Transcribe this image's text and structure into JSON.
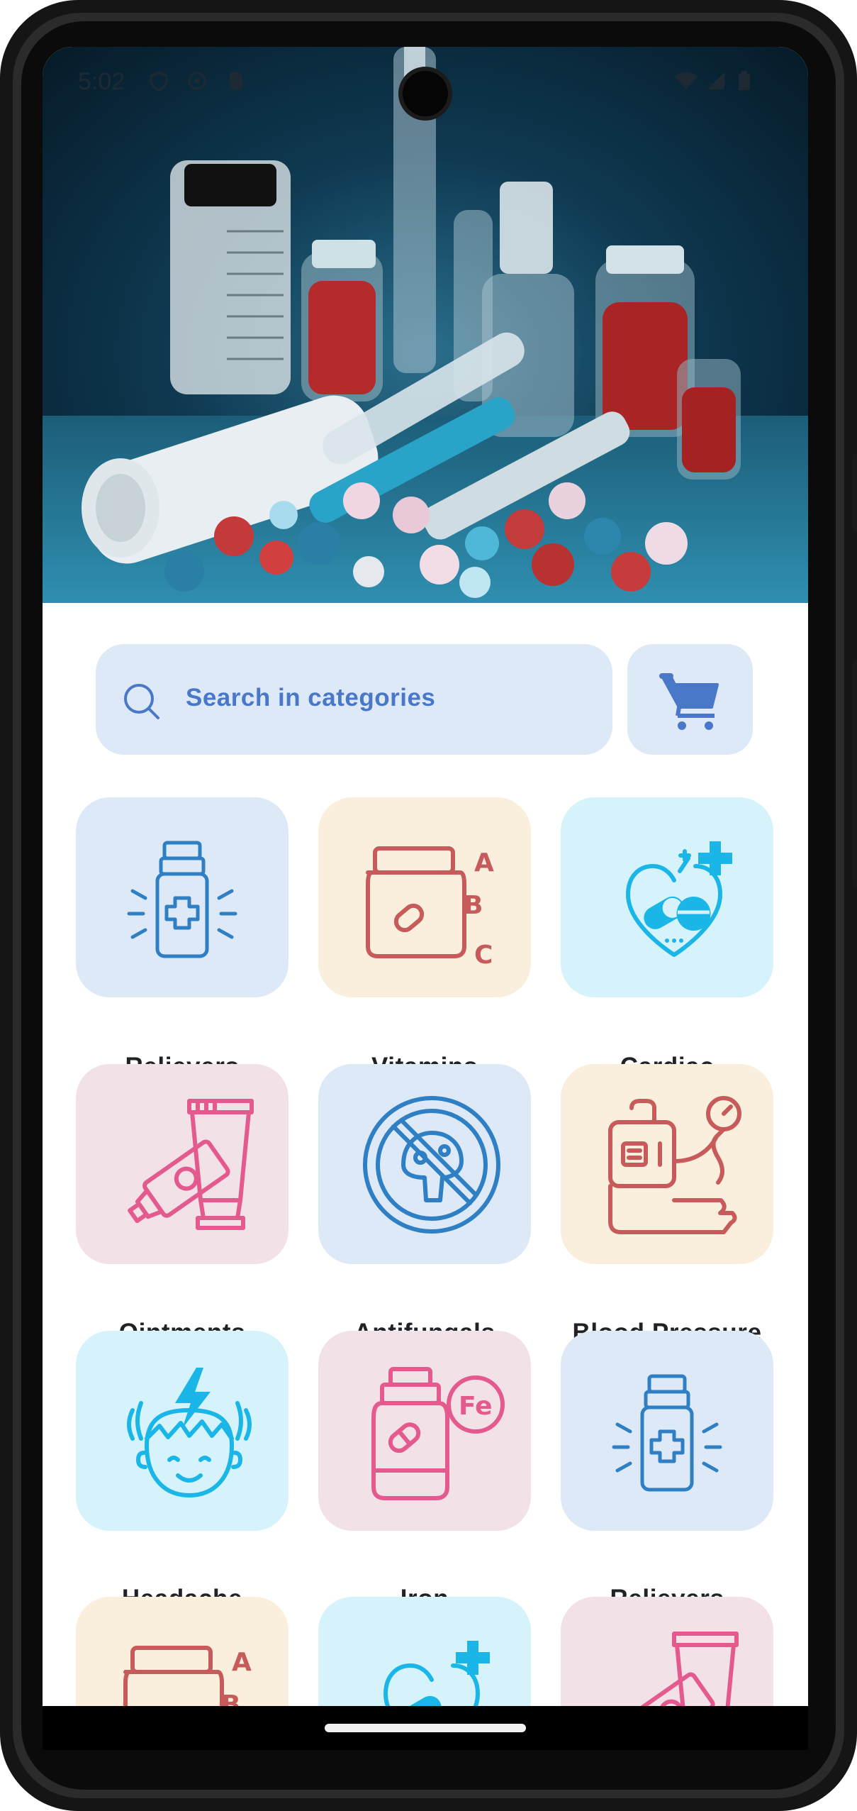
{
  "status_bar": {
    "time": "5:02"
  },
  "search": {
    "placeholder": "Search in categories"
  },
  "colors": {
    "blue_bg": "#dde9f6",
    "peach_bg": "#faefdc",
    "cyan_bg": "#d6f3fb",
    "pink_bg": "#f2e1e6",
    "blue_icon": "#2f7fc4",
    "red_icon": "#c75b5b",
    "cyan_icon": "#1ab6e8",
    "pink_icon": "#e45a8f",
    "accent": "#4a78c9"
  },
  "categories": [
    {
      "label": "Relievers",
      "icon": "pill-bottle-icon"
    },
    {
      "label": "Vitamins",
      "icon": "vitamin-jar-icon"
    },
    {
      "label": "Cardiac",
      "icon": "heart-pill-icon"
    },
    {
      "label": "Ointments",
      "icon": "ointment-tube-icon"
    },
    {
      "label": "Antifungals",
      "icon": "no-fungus-icon"
    },
    {
      "label": "Blood Pressure",
      "icon": "blood-pressure-icon"
    },
    {
      "label": "Headache",
      "icon": "headache-icon"
    },
    {
      "label": "Iron",
      "icon": "iron-supplement-icon"
    },
    {
      "label": "Relievers",
      "icon": "pill-bottle-icon"
    }
  ]
}
